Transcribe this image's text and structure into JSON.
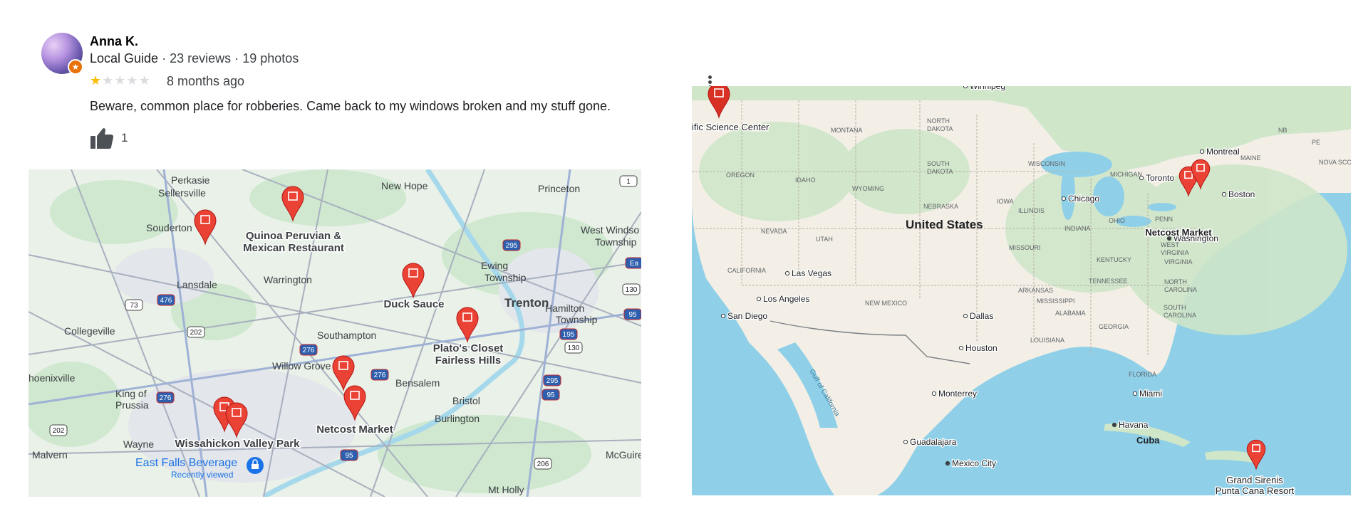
{
  "review": {
    "author": "Anna K.",
    "badge": "Local Guide",
    "reviews_count": "23 reviews",
    "photos_count": "19 photos",
    "separator": "·",
    "rating": 1,
    "rating_max": 5,
    "time_ago": "8 months ago",
    "text": "Beware, common place for robberies. Came back to my windows broken and my stuff gone.",
    "likes": "1"
  },
  "map_local": {
    "places": [
      "Perkasie",
      "Sellersville",
      "New Hope",
      "Princeton",
      "Souderton",
      "West Windsor Township",
      "Lansdale",
      "Warrington",
      "Ewing Township",
      "Trenton",
      "Hamilton Township",
      "Collegeville",
      "Southampton",
      "Willow Grove",
      "Bensalem",
      "Phoenixville",
      "King of Prussia",
      "Bristol",
      "Burlington",
      "Wayne",
      "Malvern",
      "McGuire",
      "Mt Holly"
    ],
    "markers": [
      "Quinoa Peruvian & Mexican Restaurant",
      "Duck Sauce",
      "Plato's Closet Fairless Hills",
      "Wissahickon Valley Park",
      "Netcost Market"
    ],
    "highway_shields": [
      "1",
      "295",
      "476",
      "73",
      "202",
      "276",
      "276",
      "130",
      "195",
      "130",
      "95",
      "295",
      "95",
      "95",
      "206",
      "202",
      "276",
      "Ea"
    ],
    "recent": {
      "name": "East Falls Beverage",
      "sub": "Recently viewed"
    }
  },
  "map_us": {
    "country": "United States",
    "states": [
      "NORTH DAKOTA",
      "MONTANA",
      "SOUTH DAKOTA",
      "OREGON",
      "IDAHO",
      "WYOMING",
      "NEBRASKA",
      "NEVADA",
      "UTAH",
      "CALIFORNIA",
      "NEW MEXICO",
      "IOWA",
      "ILLINOIS",
      "INDIANA",
      "OHIO",
      "PENN",
      "MISSOURI",
      "WEST VIRGINIA",
      "VIRGINIA",
      "KENTUCKY",
      "TENNESSEE",
      "NORTH CAROLINA",
      "SOUTH CAROLINA",
      "ARKANSAS",
      "MISSISSIPPI",
      "ALABAMA",
      "GEORGIA",
      "LOUISIANA",
      "FLORIDA",
      "WISCONSIN",
      "MICHIGAN",
      "MAINE",
      "NB",
      "PE",
      "NOVA SCOTIA"
    ],
    "cities": [
      "Winnipeg",
      "Montreal",
      "Toronto",
      "Boston",
      "Chicago",
      "Washington",
      "Las Vegas",
      "Los Angeles",
      "San Diego",
      "Dallas",
      "Houston",
      "Monterrey",
      "Miami",
      "Havana",
      "Guadalajara",
      "Mexico City"
    ],
    "markers": [
      "ific Science Center",
      "Netcost Market",
      "Grand Sirenis Punta Cana Resort"
    ],
    "water": [
      "Gulf of California"
    ],
    "countries": [
      "Cuba"
    ]
  },
  "colors": {
    "star_on": "#fbbc04",
    "star_off": "#dadce0",
    "pin": "#ea4335",
    "land_local": "#e9f1e8",
    "land_us": "#f3efe6",
    "water": "#8fd0e8",
    "park": "#c6e6c9",
    "recent_blue": "#1a73e8"
  },
  "icons": {
    "like": "thumbs-up-icon",
    "more": "more-vert-icon",
    "marker": "map-pin-icon",
    "badge": "local-guide-star-icon"
  }
}
